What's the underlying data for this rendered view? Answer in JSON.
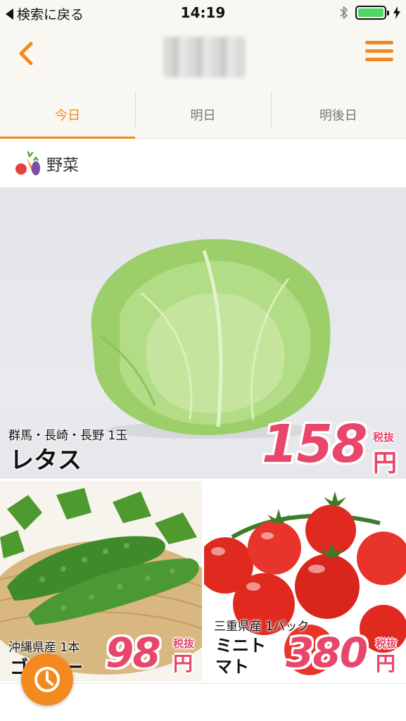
{
  "status_bar": {
    "back_label": "検索に戻る",
    "time": "14:19"
  },
  "header": {
    "title": ""
  },
  "tabs": [
    {
      "label": "今日",
      "active": true
    },
    {
      "label": "明日",
      "active": false
    },
    {
      "label": "明後日",
      "active": false
    }
  ],
  "category": {
    "label": "野菜",
    "icon": "vegetables-icon"
  },
  "products": {
    "main": {
      "origin": "群馬・長崎・長野 1玉",
      "name": "レタス",
      "price": "158",
      "tax_label": "税抜",
      "yen": "円"
    },
    "left": {
      "origin": "沖縄県産 1本",
      "name": "ゴーヤー",
      "price": "98",
      "tax_label": "税抜",
      "yen": "円"
    },
    "right": {
      "origin": "三重県産 1パック",
      "name_line1": "ミニト",
      "name_line2": "マト",
      "price": "380",
      "tax_label": "税抜",
      "yen": "円"
    }
  },
  "colors": {
    "accent": "#f28a1f",
    "price": "#e8476b",
    "header_bg": "#f8f7f1"
  },
  "fab": {
    "icon": "clock-icon"
  }
}
